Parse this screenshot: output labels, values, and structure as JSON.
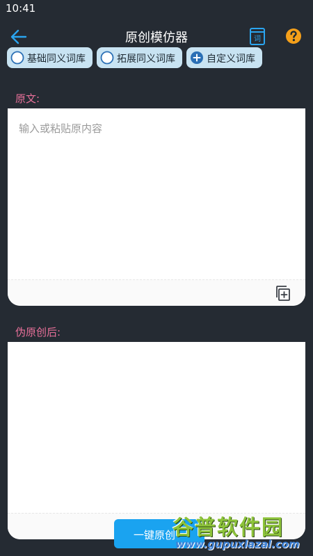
{
  "status_bar": {
    "time": "10:41"
  },
  "header": {
    "title": "原创模仿器",
    "dict_icon_glyph": "词"
  },
  "chips": [
    {
      "label": "基础同义词库",
      "icon": "radio-empty-icon"
    },
    {
      "label": "拓展同义词库",
      "icon": "radio-empty-icon"
    },
    {
      "label": "自定义词库",
      "icon": "plus-circle-icon"
    }
  ],
  "source": {
    "label": "原文:",
    "placeholder": "输入或粘贴原内容"
  },
  "result": {
    "label": "伪原创后:"
  },
  "actions": {
    "primary_label": "一键原创"
  },
  "watermark": {
    "title": "谷普软件园",
    "url": "www.gupuxlazal.com"
  },
  "colors": {
    "background": "#252b33",
    "accent": "#1aa3f0",
    "label_pink": "#e8709a",
    "chip_bg": "#c8e3f2",
    "help_orange": "#f5a01a"
  }
}
